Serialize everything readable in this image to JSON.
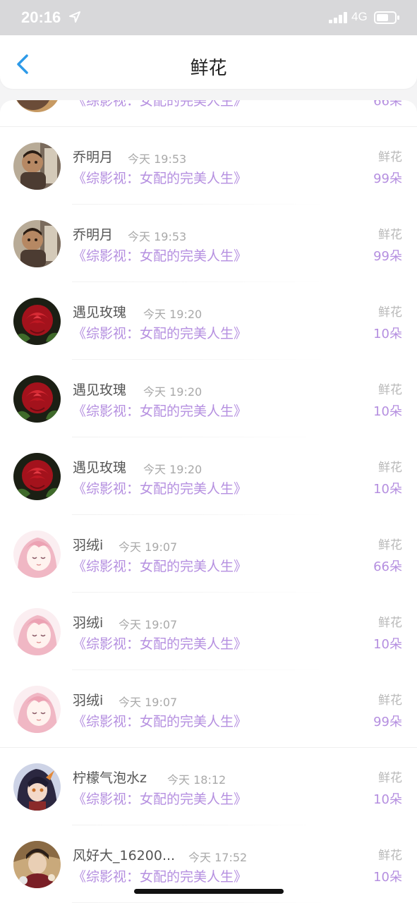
{
  "status_bar": {
    "time": "20:16",
    "network": "4G",
    "location_icon": "location-arrow-icon",
    "signal_icon": "signal-bars-icon",
    "battery_icon": "battery-icon"
  },
  "nav": {
    "title": "鲜花",
    "back_icon": "chevron-left-icon"
  },
  "partial_row": {
    "book": "《综影视：女配的完美人生》",
    "count": "66朵"
  },
  "records": [
    {
      "user": "乔明月",
      "time": "今天 19:53",
      "book": "《综影视：女配的完美人生》",
      "gift": "鲜花",
      "count": "99朵",
      "avatar": "child"
    },
    {
      "user": "乔明月",
      "time": "今天 19:53",
      "book": "《综影视：女配的完美人生》",
      "gift": "鲜花",
      "count": "99朵",
      "avatar": "child"
    },
    {
      "user": "遇见玫瑰",
      "time": "今天 19:20",
      "book": "《综影视：女配的完美人生》",
      "gift": "鲜花",
      "count": "10朵",
      "avatar": "rose"
    },
    {
      "user": "遇见玫瑰",
      "time": "今天 19:20",
      "book": "《综影视：女配的完美人生》",
      "gift": "鲜花",
      "count": "10朵",
      "avatar": "rose"
    },
    {
      "user": "遇见玫瑰",
      "time": "今天 19:20",
      "book": "《综影视：女配的完美人生》",
      "gift": "鲜花",
      "count": "10朵",
      "avatar": "rose"
    },
    {
      "user": "羽绒i",
      "time": "今天 19:07",
      "book": "《综影视：女配的完美人生》",
      "gift": "鲜花",
      "count": "66朵",
      "avatar": "pink-anime"
    },
    {
      "user": "羽绒i",
      "time": "今天 19:07",
      "book": "《综影视：女配的完美人生》",
      "gift": "鲜花",
      "count": "10朵",
      "avatar": "pink-anime"
    },
    {
      "user": "羽绒i",
      "time": "今天 19:07",
      "book": "《综影视：女配的完美人生》",
      "gift": "鲜花",
      "count": "99朵",
      "avatar": "pink-anime"
    },
    {
      "user": "柠檬气泡水z",
      "time": "今天 18:12",
      "book": "《综影视：女配的完美人生》",
      "gift": "鲜花",
      "count": "10朵",
      "avatar": "dark-anime"
    },
    {
      "user": "风好大_16200...",
      "time": "今天 17:52",
      "book": "《综影视：女配的完美人生》",
      "gift": "鲜花",
      "count": "10朵",
      "avatar": "painted"
    }
  ],
  "colors": {
    "accent": "#b58fe0",
    "status_bar": "#d8d8da",
    "background": "#f4f4f5"
  }
}
